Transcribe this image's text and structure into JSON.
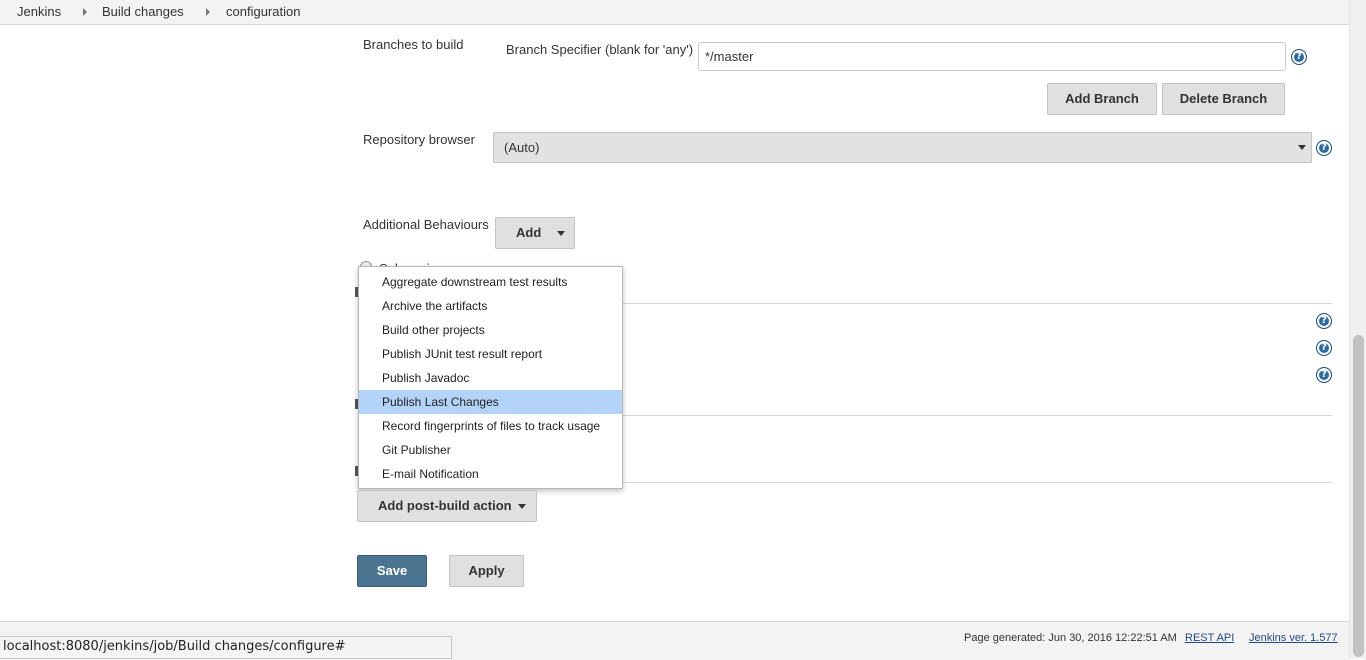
{
  "breadcrumb": [
    "Jenkins",
    "Build changes",
    "configuration"
  ],
  "branches": {
    "section_label": "Branches to build",
    "specifier_label": "Branch Specifier (blank for 'any')",
    "specifier_value": "*/master",
    "add_branch": "Add Branch",
    "delete_branch": "Delete Branch"
  },
  "repo_browser": {
    "label": "Repository browser",
    "selected": "(Auto)"
  },
  "additional_behaviours": {
    "label": "Additional Behaviours",
    "add": "Add"
  },
  "partial": {
    "radio_text": "Subversion"
  },
  "post_build_menu": {
    "items": [
      "Aggregate downstream test results",
      "Archive the artifacts",
      "Build other projects",
      "Publish JUnit test result report",
      "Publish Javadoc",
      "Publish Last Changes",
      "Record fingerprints of files to track usage",
      "Git Publisher",
      "E-mail Notification"
    ],
    "highlighted": "Publish Last Changes"
  },
  "add_post_build": "Add post-build action",
  "save": "Save",
  "apply": "Apply",
  "footer": {
    "generated": "Page generated: Jun 30, 2016 12:22:51 AM",
    "rest_api": "REST API",
    "version": "Jenkins ver. 1.577"
  },
  "status_url": "localhost:8080/jenkins/job/Build changes/configure#",
  "colors": {
    "save_bg": "#4a7490",
    "menu_highlight": "#b4d3f8",
    "help_icon": "#2d6aa3"
  },
  "icons": [
    "help-icon",
    "chevron-down-icon",
    "breadcrumb-arrow-icon"
  ]
}
